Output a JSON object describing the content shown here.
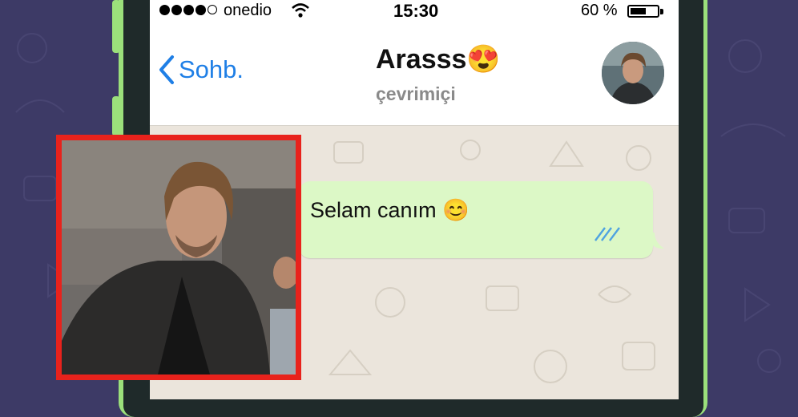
{
  "status_bar": {
    "carrier": "onedio",
    "time": "15:30",
    "battery": "60 %",
    "battery_level": 0.6,
    "signal_bars_filled": 4,
    "signal_bars_total": 5
  },
  "header": {
    "back_label": "Sohb.",
    "contact_name": "Arasss",
    "contact_emoji": "😍",
    "contact_status": "çevrimiçi"
  },
  "messages": [
    {
      "text": "Selam canım",
      "emoji": "😊",
      "status": "read"
    }
  ],
  "colors": {
    "accent": "#1f7fe6",
    "bubble": "#dcf8c6",
    "ticks": "#4fa3e0",
    "photo_frame": "#e8221c",
    "phone_case": "#9be07b",
    "background": "#3d3a66"
  },
  "icons": {
    "wifi": "wifi-icon",
    "back": "chevron-left-icon",
    "ticks": "double-check-icon"
  }
}
